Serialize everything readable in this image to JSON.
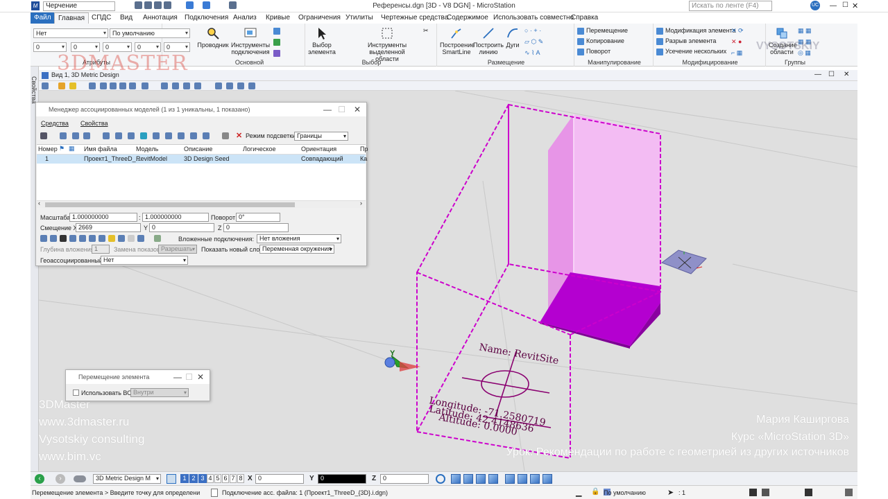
{
  "app": {
    "workspace": "Черчение",
    "title": "Референсы.dgn [3D - V8 DGN] - MicroStation",
    "search_placeholder": "Искать по ленте (F4)",
    "user_initials": "UC"
  },
  "tabs": [
    "Файл",
    "Главная",
    "СПДС",
    "Вид",
    "Аннотация",
    "Подключения",
    "Анализ",
    "Кривые",
    "Ограничения",
    "Утилиты",
    "Чертежные средства",
    "Содержимое",
    "Использовать совместно",
    "Справка"
  ],
  "ribbon": {
    "attributes": {
      "level": "Нет",
      "style": "По умолчанию",
      "color": "0",
      "weight": "0",
      "linestyle": "0",
      "trans": "0",
      "priority": "0",
      "label": "Атрибуты"
    },
    "main": {
      "explorer": "Проводник",
      "attach_tools": "Инструменты подключения",
      "label": "Основной"
    },
    "select": {
      "select_element": "Выбор элемента",
      "region_tools": "Инструменты выделенной области",
      "label": "Выбор"
    },
    "placement": {
      "smartline": "Построение SmartLine",
      "line": "Построить линию",
      "arcs": "Дуги",
      "label": "Размещение"
    },
    "manipulate": {
      "move": "Перемещение",
      "copy": "Копирование",
      "rotate": "Поворот",
      "label": "Манипулирование"
    },
    "modify": {
      "modify_element": "Модификация элемента",
      "break": "Разрыв элемента",
      "trim": "Усечение нескольких",
      "label": "Модифицирование"
    },
    "groups": {
      "create_region": "Создание области",
      "label": "Группы"
    }
  },
  "side_panel": "Свойства",
  "view": {
    "title": "Вид 1, 3D Metric Design"
  },
  "ref_manager": {
    "title": "Менеджер ассоциированных моделей (1 из 1 уникальны, 1 показано)",
    "menu": [
      "Средства",
      "Свойства"
    ],
    "highlight_label": "Режим подсветки:",
    "highlight_value": "Границы",
    "columns": [
      "Номер",
      "Имя файла",
      "Модель",
      "Описание",
      "Логическое",
      "Ориентация",
      "Пр"
    ],
    "rows": [
      {
        "num": "1",
        "file": "Проект1_ThreeD_...",
        "model": "RevitModel",
        "desc": "3D Design Seed",
        "logical": "",
        "orient": "Совпадающий",
        "p": "Ка"
      }
    ],
    "scale_label": "Масштаба",
    "scale1": "1.000000000",
    "scale2": "1.000000000",
    "rotation_label": "Поворот",
    "rotation": "0°",
    "offset_label": "Смещение X",
    "offset_x": "2669",
    "y_label": "Y",
    "offset_y": "0",
    "z_label": "Z",
    "offset_z": "0",
    "nested_label": "Вложенные подключения:",
    "nested_value": "Нет вложения",
    "depth_label": "Глубина вложения:",
    "depth_value": "1",
    "display_override_label": "Замена показов:",
    "display_override_value": "Разрешать",
    "new_level_label": "Показать новый слой:",
    "new_level_value": "Переменная окружения",
    "geo_label": "Геоассоциированный:",
    "geo_value": "Нет"
  },
  "move_dialog": {
    "title": "Перемещение элемента",
    "use_ac_label": "Использовать ВО:",
    "use_ac_value": "Внутри"
  },
  "site_text": {
    "name": "Name: RevitSite",
    "longitude": "Longitude: -71.2580719",
    "latitude": "Latitude: 42.4148636",
    "altitude": "Altitude: 0.0000"
  },
  "watermark_left": [
    "3DMaster",
    "www.3dmaster.ru",
    "Vysotskiy consulting",
    "www.bim.vc"
  ],
  "watermark_right": [
    "Мария Каширгова",
    "Курс «MicroStation 3D»",
    "Урок: Рекомендации по работе с геометрией из других источников"
  ],
  "logo_3dmaster": "3DMASTER",
  "logo_vysotskiy": "VYSOTSKIY",
  "bottom": {
    "view_model": "3D Metric Design M",
    "views": [
      "1",
      "2",
      "3",
      "4",
      "5",
      "6",
      "7",
      "8"
    ],
    "x_label": "X",
    "x_value": "0",
    "y_label": "Y",
    "y_value": "0",
    "z_label": "Z",
    "z_value": "0"
  },
  "status": {
    "prompt": "Перемещение элемента > Введите точку для определения расст",
    "message": "Подключение асс. файла: 1 (Проект1_ThreeD_{3D}.i.dgn)",
    "level": "По умолчанию",
    "selection": ": 1"
  },
  "colors": {
    "accent": "#2a6fbf",
    "magenta": "#cc00cc",
    "pink_wall": "#f0a8f0",
    "slab": "#b000c8"
  }
}
